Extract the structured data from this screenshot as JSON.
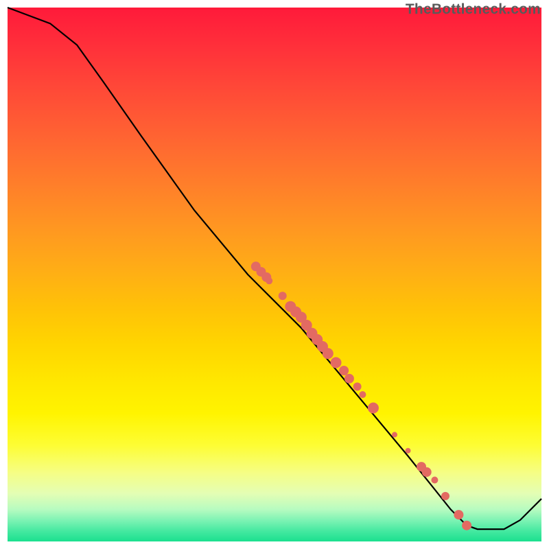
{
  "watermark": "TheBottleneck.com",
  "chart_data": {
    "type": "line",
    "title": "",
    "xlabel": "",
    "ylabel": "",
    "xlim": [
      0,
      100
    ],
    "ylim": [
      0,
      100
    ],
    "grid": false,
    "legend": false,
    "curve": [
      {
        "x": 0,
        "y": 100
      },
      {
        "x": 8,
        "y": 97
      },
      {
        "x": 13,
        "y": 93
      },
      {
        "x": 18,
        "y": 86
      },
      {
        "x": 25,
        "y": 76
      },
      {
        "x": 35,
        "y": 62
      },
      {
        "x": 45,
        "y": 50
      },
      {
        "x": 55,
        "y": 40
      },
      {
        "x": 65,
        "y": 28
      },
      {
        "x": 75,
        "y": 16
      },
      {
        "x": 83,
        "y": 6
      },
      {
        "x": 86,
        "y": 3
      },
      {
        "x": 88,
        "y": 2.3
      },
      {
        "x": 93,
        "y": 2.3
      },
      {
        "x": 96,
        "y": 4
      },
      {
        "x": 100,
        "y": 8
      }
    ],
    "scatter_points": [
      {
        "x": 46.5,
        "y": 51.5,
        "r": 7
      },
      {
        "x": 47.5,
        "y": 50.5,
        "r": 7
      },
      {
        "x": 48.5,
        "y": 49.5,
        "r": 7
      },
      {
        "x": 49.0,
        "y": 48.8,
        "r": 5
      },
      {
        "x": 51.5,
        "y": 46.0,
        "r": 6
      },
      {
        "x": 53.0,
        "y": 44.0,
        "r": 8
      },
      {
        "x": 54.0,
        "y": 43.0,
        "r": 8
      },
      {
        "x": 55.0,
        "y": 42.0,
        "r": 8
      },
      {
        "x": 56.0,
        "y": 40.5,
        "r": 8
      },
      {
        "x": 57.0,
        "y": 39.0,
        "r": 8
      },
      {
        "x": 58.0,
        "y": 37.8,
        "r": 8
      },
      {
        "x": 59.0,
        "y": 36.5,
        "r": 8
      },
      {
        "x": 60.0,
        "y": 35.2,
        "r": 8
      },
      {
        "x": 61.5,
        "y": 33.5,
        "r": 8
      },
      {
        "x": 63.0,
        "y": 32.0,
        "r": 7
      },
      {
        "x": 64.0,
        "y": 30.5,
        "r": 7
      },
      {
        "x": 65.5,
        "y": 29.0,
        "r": 6
      },
      {
        "x": 66.5,
        "y": 27.5,
        "r": 5
      },
      {
        "x": 68.5,
        "y": 25.0,
        "r": 8
      },
      {
        "x": 72.5,
        "y": 20.0,
        "r": 4
      },
      {
        "x": 75.0,
        "y": 17.0,
        "r": 4
      },
      {
        "x": 77.5,
        "y": 14.0,
        "r": 7
      },
      {
        "x": 78.5,
        "y": 13.0,
        "r": 7
      },
      {
        "x": 80.0,
        "y": 11.5,
        "r": 5
      },
      {
        "x": 82.0,
        "y": 8.5,
        "r": 6
      },
      {
        "x": 84.5,
        "y": 5.0,
        "r": 7
      },
      {
        "x": 86.0,
        "y": 3.0,
        "r": 7
      }
    ],
    "colors": {
      "line": "#000000",
      "marker_fill": "#e36a62",
      "marker_stroke": "#e05a52",
      "gradient_top": "#ff1a3a",
      "gradient_bottom": "#1be08f"
    }
  }
}
